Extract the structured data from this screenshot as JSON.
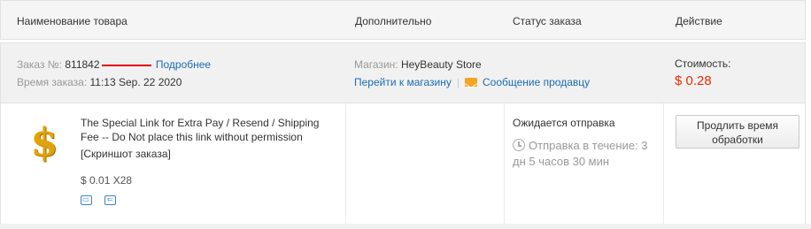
{
  "header": {
    "name": "Наименование товара",
    "extra": "Дополнительно",
    "status": "Статус заказа",
    "action": "Действие"
  },
  "order": {
    "number_label": "Заказ №:",
    "number_prefix": "811842",
    "more_link": "Подробнее",
    "time_label": "Время заказа:",
    "time_value": "11:13 Sep. 22 2020",
    "store_label": "Магазин:",
    "store_name": "HeyBeauty Store",
    "go_store_link": "Перейти к магазину",
    "separator": "|",
    "message_link": "Сообщение продавцу",
    "cost_label": "Стоимость:",
    "cost_value": "$ 0.28",
    "cost_color": "#e62e04"
  },
  "product": {
    "icon": "dollar-icon",
    "title": "The Special Link for Extra Pay / Resend / Shipping Fee -- Do Not place this link without permission",
    "screenshot_label": "[Скриншот заказа]",
    "price_qty": "$ 0.01 X28",
    "status": "Ожидается отправка",
    "timer_text": "Отправка в течение: 3 дн 5 часов 30 мин",
    "action_button": "Продлить время обработки"
  }
}
